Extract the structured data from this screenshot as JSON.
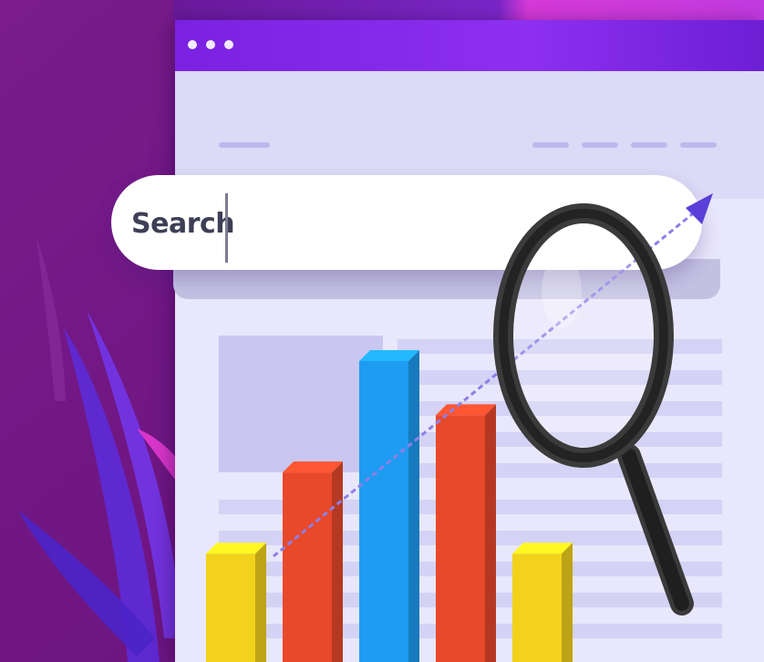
{
  "search": {
    "label": "Search",
    "icon": "magnifier-icon"
  },
  "window": {
    "controls": [
      "dot",
      "dot",
      "dot"
    ]
  },
  "illustration": {
    "chart_icon": "bar-chart-icon",
    "trend_icon": "trend-arrow-icon",
    "bars": [
      {
        "relative_height": 0.36,
        "color": "#f2d21c"
      },
      {
        "relative_height": 0.63,
        "color": "#e8492b"
      },
      {
        "relative_height": 1.0,
        "color": "#1e9cf2"
      },
      {
        "relative_height": 0.82,
        "color": "#e8492b"
      },
      {
        "relative_height": 0.36,
        "color": "#f2d21c"
      }
    ]
  },
  "colors": {
    "background": "#7a1a86",
    "accent": "#8d2ff0",
    "page": "#e9e7fb"
  }
}
